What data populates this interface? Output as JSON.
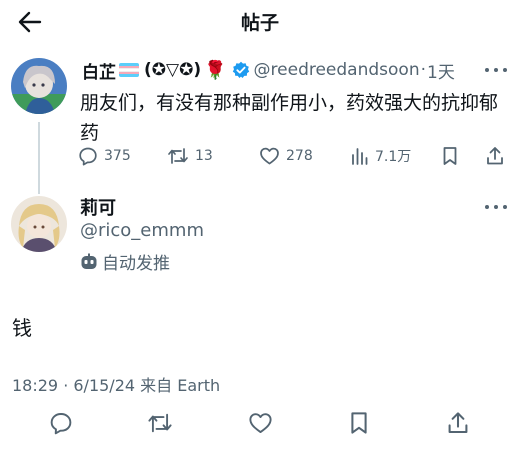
{
  "header": {
    "title": "帖子",
    "back_icon": "arrow-left-icon"
  },
  "post": {
    "display_name": "白芷",
    "name_flag_icon": "transgender-flag-icon",
    "name_kaomoji": "(✪▽✪)",
    "name_emoji": "🌹",
    "verified_icon": "verified-badge-icon",
    "handle": "@reedreedandsoon",
    "separator": "·",
    "time": "1天",
    "text": "朋友们，有没有那种副作用小，药效强大的抗抑郁药",
    "actions": {
      "replies": "375",
      "reposts": "13",
      "likes": "278",
      "views": "7.1万"
    }
  },
  "reply": {
    "display_name": "莉可",
    "handle": "@rico_emmm",
    "automated_icon": "robot-icon",
    "automated_label": "自动发推",
    "text": "钱",
    "timestamp": "18:29 · 6/15/24 来自 Earth"
  },
  "colors": {
    "text": "#0f1419",
    "muted": "#536471",
    "verified": "#1d9bf0",
    "thread_line": "#cfd9de",
    "flag_blue": "#5bcefa",
    "flag_pink": "#f5a9b8"
  }
}
